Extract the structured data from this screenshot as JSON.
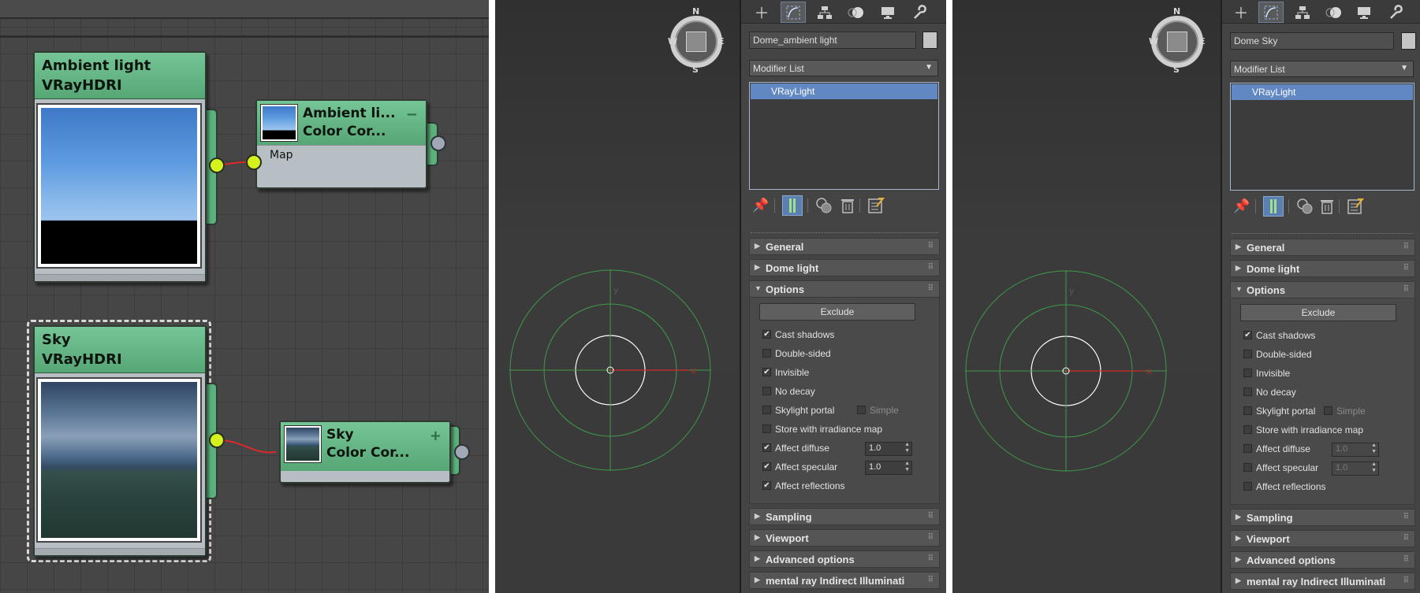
{
  "node_editor": {
    "ambient_node": {
      "title": "Ambient light",
      "subtitle": "VRayHDRI"
    },
    "ambient_cc": {
      "title": "Ambient li...",
      "subtitle": "Color Cor...",
      "slot_label": "Map",
      "button": "−"
    },
    "sky_node": {
      "title": "Sky",
      "subtitle": "VRayHDRI"
    },
    "sky_cc": {
      "title": "Sky",
      "subtitle": "Color Cor...",
      "button": "+"
    }
  },
  "viewport_left": {
    "compass": {
      "n": "N",
      "s": "S",
      "e": "E",
      "w": "W"
    },
    "axes": {
      "y": "y",
      "x": "x"
    }
  },
  "viewport_right": {
    "compass": {
      "n": "N",
      "s": "S",
      "e": "E",
      "w": "W"
    },
    "axes": {
      "y": "y",
      "x": "x"
    }
  },
  "panel_left": {
    "object_name": "Dome_ambient light",
    "modifier_list": "Modifier List",
    "stack_item": "VRayLight",
    "rollouts": [
      "General",
      "Dome light",
      "Options",
      "Sampling",
      "Viewport",
      "Advanced options",
      "mental ray Indirect Illuminati"
    ],
    "exclude": "Exclude",
    "options": {
      "cast_shadows": {
        "label": "Cast shadows",
        "checked": true
      },
      "double_sided": {
        "label": "Double-sided",
        "checked": false
      },
      "invisible": {
        "label": "Invisible",
        "checked": true
      },
      "no_decay": {
        "label": "No decay",
        "checked": false
      },
      "skylight_portal": {
        "label": "Skylight portal",
        "checked": false
      },
      "simple": {
        "label": "Simple",
        "checked": false
      },
      "store_irradiance": {
        "label": "Store with irradiance map",
        "checked": false
      },
      "affect_diffuse": {
        "label": "Affect diffuse",
        "checked": true,
        "value": "1.0"
      },
      "affect_specular": {
        "label": "Affect specular",
        "checked": true,
        "value": "1.0"
      },
      "affect_reflections": {
        "label": "Affect reflections",
        "checked": true
      }
    }
  },
  "panel_right": {
    "object_name": "Dome Sky",
    "modifier_list": "Modifier List",
    "stack_item": "VRayLight",
    "rollouts": [
      "General",
      "Dome light",
      "Options",
      "Sampling",
      "Viewport",
      "Advanced options",
      "mental ray Indirect Illuminati"
    ],
    "exclude": "Exclude",
    "options": {
      "cast_shadows": {
        "label": "Cast shadows",
        "checked": true
      },
      "double_sided": {
        "label": "Double-sided",
        "checked": false
      },
      "invisible": {
        "label": "Invisible",
        "checked": false
      },
      "no_decay": {
        "label": "No decay",
        "checked": false
      },
      "skylight_portal": {
        "label": "Skylight portal",
        "checked": false
      },
      "simple": {
        "label": "Simple",
        "checked": false
      },
      "store_irradiance": {
        "label": "Store with irradiance map",
        "checked": false
      },
      "affect_diffuse": {
        "label": "Affect diffuse",
        "checked": false,
        "value": "1.0"
      },
      "affect_specular": {
        "label": "Affect specular",
        "checked": false,
        "value": "1.0"
      },
      "affect_reflections": {
        "label": "Affect reflections",
        "checked": false
      }
    }
  },
  "check_glyph": "✔",
  "colors": {
    "node_header": "#5fb07f",
    "port": "#d5f21f",
    "wire": "#e02828",
    "selection": "#6188c2",
    "grid_green": "#3f9a4a"
  }
}
